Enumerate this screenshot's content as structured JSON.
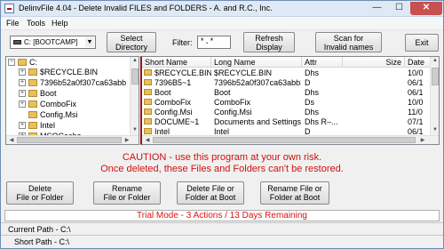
{
  "window": {
    "title": "DelinvFile 4.04 - Delete Invalid FILES and FOLDERS - A. and R.C., Inc.",
    "minimize": "—",
    "maximize": "☐",
    "close": "✕"
  },
  "menu": {
    "items": [
      "File",
      "Tools",
      "Help"
    ]
  },
  "toolbar": {
    "drive": "C: [BOOTCAMP]",
    "select_directory_label": "Select\nDirectory",
    "filter_label": "Filter:",
    "filter_value": "*.*",
    "refresh_label": "Refresh\nDisplay",
    "scan_label": "Scan for\nInvalid names",
    "exit_label": "Exit"
  },
  "tree": {
    "root": "C:",
    "items": [
      "$RECYCLE.BIN",
      "7396b52a0f307ca63abb",
      "Boot",
      "ComboFix",
      "Config.Msi",
      "Intel",
      "MSOCache"
    ]
  },
  "list": {
    "columns": [
      "Short Name",
      "Long Name",
      "Attr",
      "Size",
      "Date"
    ],
    "rows": [
      {
        "short": "$RECYCLE.BIN",
        "long": "$RECYCLE.BIN",
        "attr": "Dhs",
        "size": "",
        "date": "10/0"
      },
      {
        "short": "7396B5~1",
        "long": "7396b52a0f307ca63abb3...",
        "attr": "D",
        "size": "",
        "date": "06/1"
      },
      {
        "short": "Boot",
        "long": "Boot",
        "attr": "Dhs",
        "size": "",
        "date": "06/1"
      },
      {
        "short": "ComboFix",
        "long": "ComboFix",
        "attr": "Ds",
        "size": "",
        "date": "10/0"
      },
      {
        "short": "Config.Msi",
        "long": "Config.Msi",
        "attr": "Dhs",
        "size": "",
        "date": "11/0"
      },
      {
        "short": "DOCUME~1",
        "long": "Documents and Settings",
        "attr": "Dhs R–...",
        "size": "",
        "date": "07/1"
      },
      {
        "short": "Intel",
        "long": "Intel",
        "attr": "D",
        "size": "",
        "date": "06/1"
      }
    ]
  },
  "caution": {
    "line1": "CAUTION - use this program at your own risk.",
    "line2": "Once deleted, these Files and Folders can't be restored."
  },
  "actions": {
    "delete": "Delete\nFile or Folder",
    "rename": "Rename\nFile or Folder",
    "delete_boot": "Delete File or\nFolder at Boot",
    "rename_boot": "Rename File or\nFolder at Boot"
  },
  "trial": "Trial Mode - 3 Actions / 13 Days Remaining",
  "paths": {
    "current": "Current Path - C:\\",
    "short": "Short Path - C:\\"
  },
  "colors": {
    "caution": "#d01010",
    "trial": "#e01010",
    "divider": "#8b1a1a"
  }
}
